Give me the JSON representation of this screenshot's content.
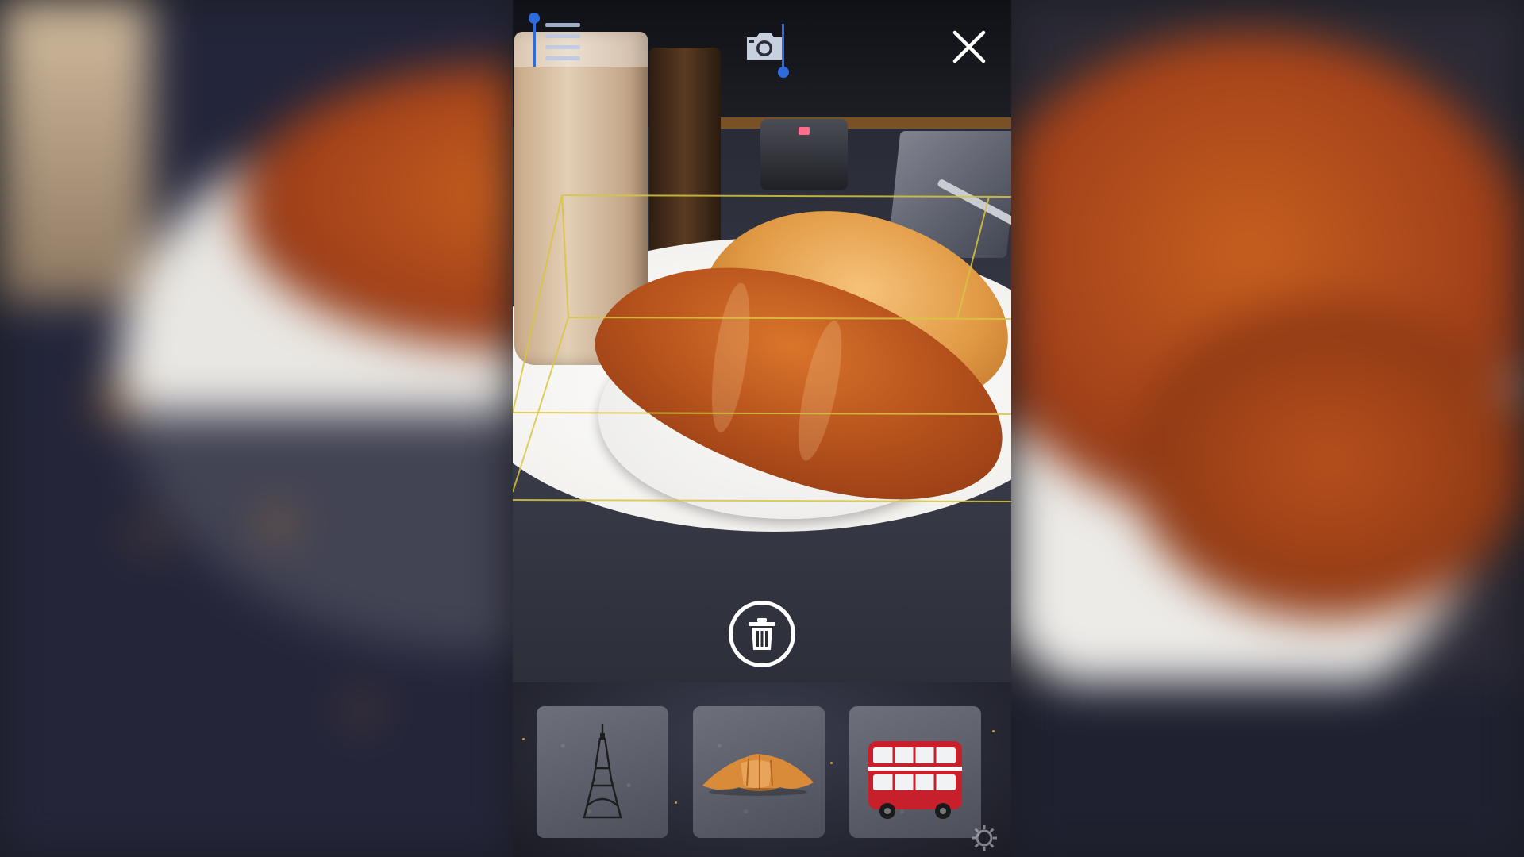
{
  "app": {
    "toolbar": {
      "menu_icon": "hamburger-menu-icon",
      "camera_icon": "camera-icon",
      "close_icon": "close-x-icon"
    },
    "placement": {
      "delete_icon": "trash-can-icon"
    },
    "model_tray": {
      "items": [
        {
          "icon": "eiffel-tower-model-icon"
        },
        {
          "icon": "croissant-model-icon"
        },
        {
          "icon": "double-decker-bus-model-icon"
        }
      ],
      "settings_icon": "gear-icon"
    },
    "colors": {
      "selection_handle": "#2f6bdc",
      "ar_bounding_box": "#d8c640",
      "bus_red": "#c8202a",
      "icon_white": "#ffffff"
    }
  }
}
